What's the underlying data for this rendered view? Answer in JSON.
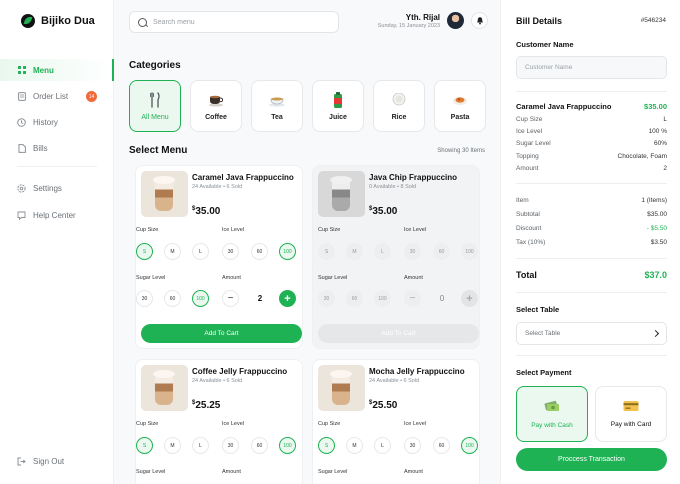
{
  "app": {
    "name": "Bijiko Dua",
    "accent": "#1fb254"
  },
  "sidebar": {
    "items": [
      {
        "label": "Menu",
        "icon": "grid-icon"
      },
      {
        "label": "Order List",
        "icon": "receipt-icon",
        "badge": "14"
      },
      {
        "label": "History",
        "icon": "clock-icon"
      },
      {
        "label": "Bills",
        "icon": "document-icon"
      },
      {
        "label": "Settings",
        "icon": "gear-icon"
      },
      {
        "label": "Help Center",
        "icon": "help-icon"
      }
    ],
    "signout": "Sign Out"
  },
  "header": {
    "search_placeholder": "Search menu",
    "user_name": "Yth. Rijal",
    "date": "Sunday, 15 January 2023"
  },
  "categories": {
    "title": "Categories",
    "items": [
      {
        "label": "All Menu",
        "icon": "utensils-icon"
      },
      {
        "label": "Coffee",
        "icon": "coffee-cup-icon"
      },
      {
        "label": "Tea",
        "icon": "teapot-icon"
      },
      {
        "label": "Juice",
        "icon": "juice-icon"
      },
      {
        "label": "Rice",
        "icon": "rice-bowl-icon"
      },
      {
        "label": "Pasta",
        "icon": "pasta-icon"
      }
    ]
  },
  "menu": {
    "title": "Select Menu",
    "showing": "Showing 30 Items",
    "labels": {
      "cup_size": "Cup Size",
      "ice_level": "Ice Level",
      "sugar_level": "Sugar Level",
      "amount": "Amount",
      "add_to_cart": "Add To Cart"
    },
    "cup_sizes": [
      "S",
      "M",
      "L"
    ],
    "levels": [
      "30",
      "60",
      "100"
    ],
    "items": [
      {
        "name": "Caramel Java Frappuccino",
        "stock": "24 Available  •  6 Sold",
        "currency": "$",
        "price": "35.00",
        "qty": "2",
        "available": true
      },
      {
        "name": "Java Chip Frappuccino",
        "stock": "0 Available  •  8 Sold",
        "currency": "$",
        "price": "35.00",
        "qty": "0",
        "available": false
      },
      {
        "name": "Coffee Jelly Frappuccino",
        "stock": "24 Available  •  6 Sold",
        "currency": "$",
        "price": "25.25",
        "qty": "",
        "available": true
      },
      {
        "name": "Mocha Jelly Frappuccino",
        "stock": "24 Available  •  6 Sold",
        "currency": "$",
        "price": "25.50",
        "qty": "",
        "available": true
      }
    ]
  },
  "bill": {
    "title": "Bill Details",
    "id": "#546234",
    "customer_label": "Customer Name",
    "customer_placeholder": "Customer Name",
    "item": {
      "name": "Caramel Java Frappuccino",
      "price": "$35.00",
      "details": [
        {
          "k": "Cup Size",
          "v": "L"
        },
        {
          "k": "Ice Level",
          "v": "100 %"
        },
        {
          "k": "Sugar Level",
          "v": "60%"
        },
        {
          "k": "Topping",
          "v": "Chocolate, Foam"
        },
        {
          "k": "Amount",
          "v": "2"
        }
      ]
    },
    "summary": [
      {
        "k": "Item",
        "v": "1 (Items)"
      },
      {
        "k": "Subtotal",
        "v": "$35.00"
      },
      {
        "k": "Discount",
        "v": "- $5.50"
      },
      {
        "k": "Tax (10%)",
        "v": "$3.50"
      }
    ],
    "total_label": "Total",
    "total": "$37.0",
    "table_label": "Select Table",
    "table_placeholder": "Select Table",
    "payment_label": "Select Payment",
    "pay_cash": "Pay with Cash",
    "pay_card": "Pay with Card",
    "process": "Proccess Transaction"
  }
}
